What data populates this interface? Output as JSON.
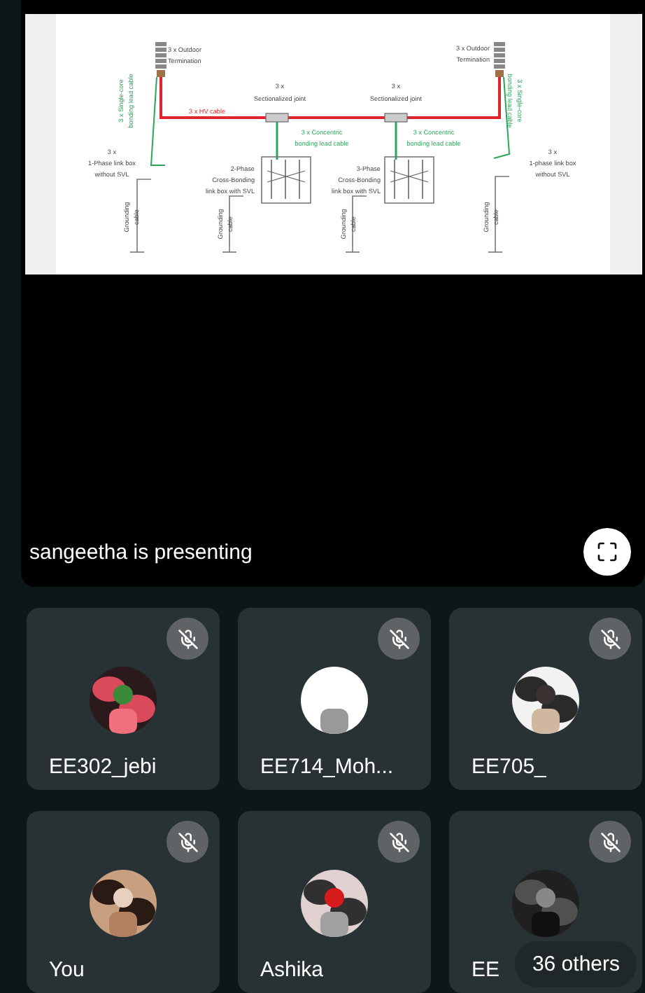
{
  "presentation": {
    "slide": {
      "labels": [
        {
          "text": "3 x Outdoor"
        },
        {
          "text": "Termination"
        },
        {
          "text": "3 x Outdoor"
        },
        {
          "text": "Termination"
        },
        {
          "text": "3 x"
        },
        {
          "text": "Sectionalized joint"
        },
        {
          "text": "3 x"
        },
        {
          "text": "Sectionalized joint"
        },
        {
          "text": "3 x  HV cable"
        },
        {
          "text": "3 x Concentric"
        },
        {
          "text": "bonding lead cable"
        },
        {
          "text": "3 x Concentric"
        },
        {
          "text": "bonding lead cable"
        },
        {
          "text": "3 x Single-core"
        },
        {
          "text": "bonding lead cable"
        },
        {
          "text": "3 x Single-core"
        },
        {
          "text": "bonding lead cable"
        },
        {
          "text": "3 x"
        },
        {
          "text": "1-Phase link box"
        },
        {
          "text": "without SVL"
        },
        {
          "text": "2-Phase"
        },
        {
          "text": "Cross-Bonding"
        },
        {
          "text": "link box with SVL"
        },
        {
          "text": "3-Phase"
        },
        {
          "text": "Cross-Bonding"
        },
        {
          "text": "link box with SVL"
        },
        {
          "text": "3 x"
        },
        {
          "text": "1-phase link box"
        },
        {
          "text": "without SVL"
        },
        {
          "text": "Grounding"
        },
        {
          "text": "cable"
        },
        {
          "text": "Grounding"
        },
        {
          "text": "cable"
        },
        {
          "text": "Grounding"
        },
        {
          "text": "cable"
        },
        {
          "text": "Grounding"
        },
        {
          "text": "cable"
        }
      ]
    },
    "caption": "sangeetha is presenting"
  },
  "participants": [
    {
      "name": "EE302_jebi",
      "muted": true
    },
    {
      "name": "EE714_Moh...",
      "muted": true
    },
    {
      "name": "EE705_",
      "muted": true
    },
    {
      "name": "You",
      "muted": true
    },
    {
      "name": "Ashika",
      "muted": true
    },
    {
      "name": "EE",
      "muted": true
    }
  ],
  "others_badge": "36 others"
}
